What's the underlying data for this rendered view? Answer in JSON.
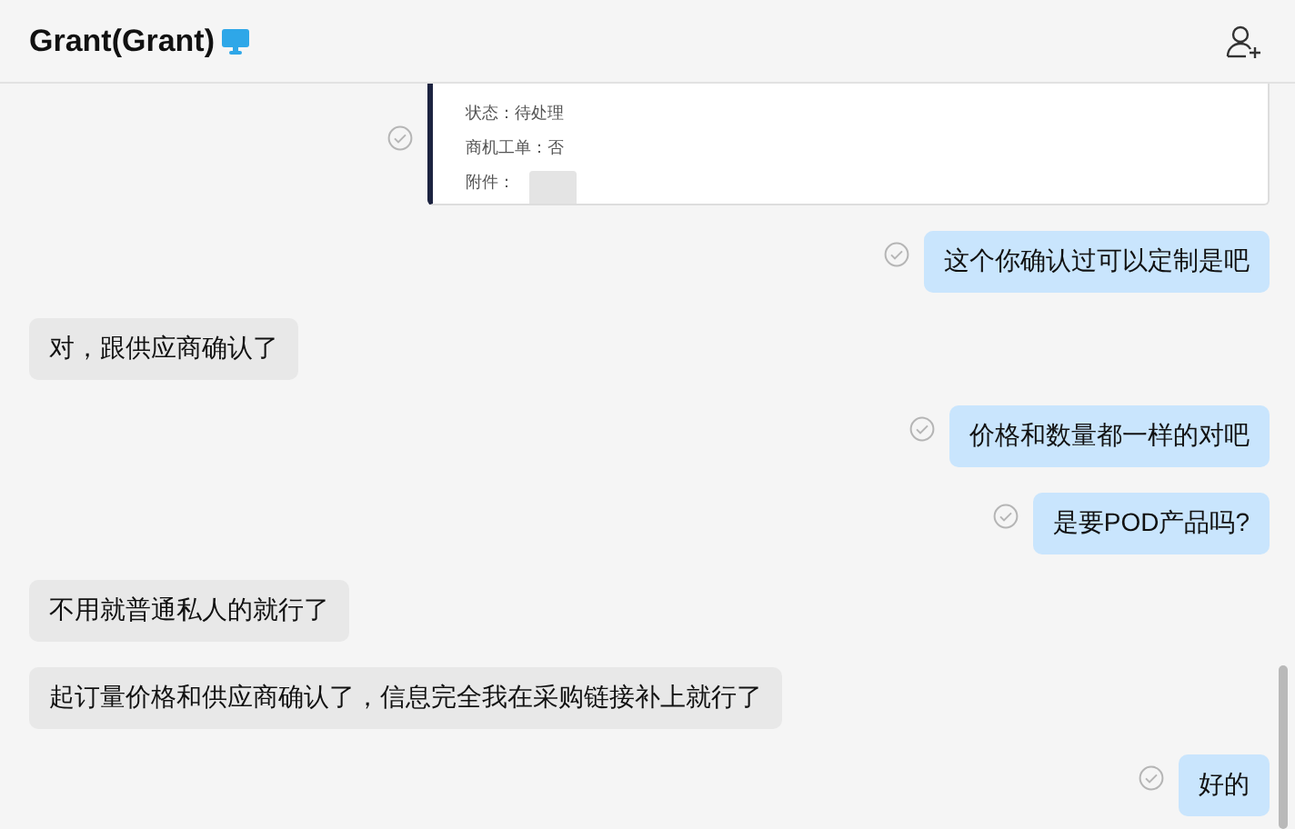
{
  "header": {
    "title": "Grant(Grant)"
  },
  "messages": [
    {
      "kind": "screenshot",
      "outgoing": true,
      "fields": [
        {
          "label": "状态：",
          "value": "待处理"
        },
        {
          "label": "商机工单：",
          "value": "否"
        }
      ],
      "attachment_label": "附件："
    },
    {
      "kind": "text",
      "outgoing": true,
      "text": "这个你确认过可以定制是吧"
    },
    {
      "kind": "text",
      "outgoing": false,
      "text": "对，跟供应商确认了"
    },
    {
      "kind": "text",
      "outgoing": true,
      "text": "价格和数量都一样的对吧"
    },
    {
      "kind": "text",
      "outgoing": true,
      "text": "是要POD产品吗?"
    },
    {
      "kind": "text",
      "outgoing": false,
      "text": "不用就普通私人的就行了"
    },
    {
      "kind": "text",
      "outgoing": false,
      "text": "起订量价格和供应商确认了，信息完全我在采购链接补上就行了"
    },
    {
      "kind": "text",
      "outgoing": true,
      "text": "好的"
    }
  ]
}
